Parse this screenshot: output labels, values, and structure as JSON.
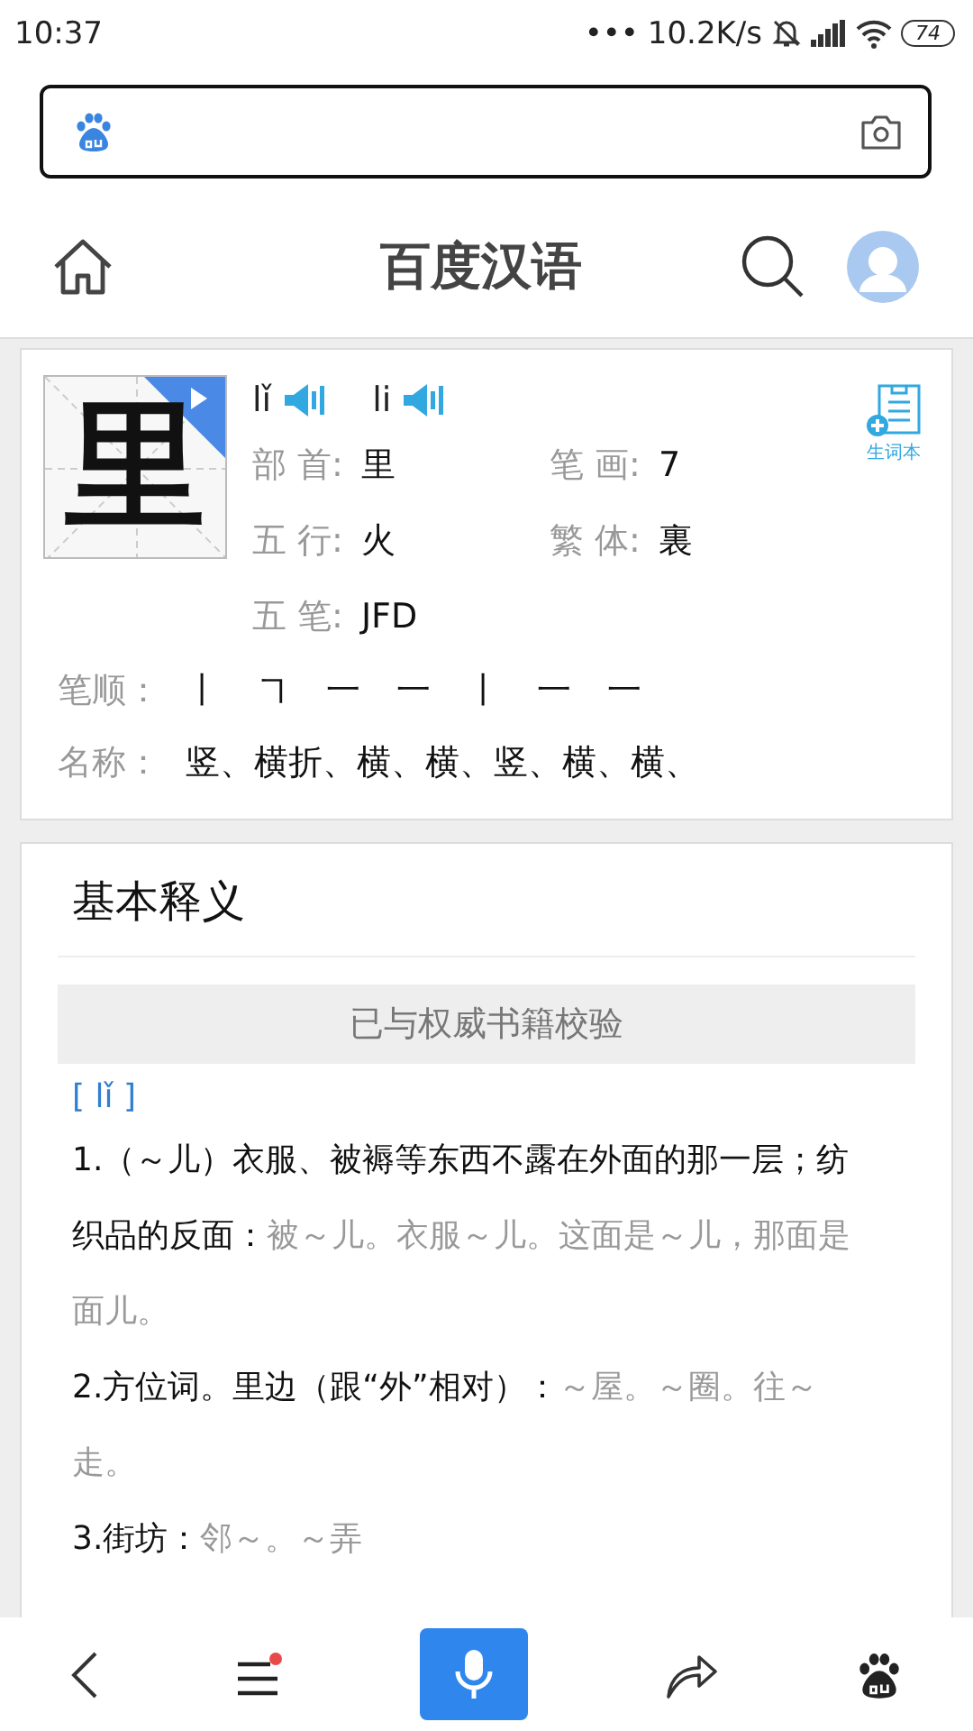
{
  "status_bar": {
    "time": "10:37",
    "dots": "•••",
    "speed": "10.2K/s",
    "battery": "74"
  },
  "header": {
    "title": "百度汉语"
  },
  "character": {
    "glyph": "里",
    "pinyin": [
      {
        "text": "lǐ"
      },
      {
        "text": "li"
      }
    ],
    "add_label": "生词本",
    "fields": [
      {
        "label": "部 首:",
        "value": "里"
      },
      {
        "label": "笔 画:",
        "value": "7"
      },
      {
        "label": "五 行:",
        "value": "火"
      },
      {
        "label": "繁 体:",
        "value": "裏"
      },
      {
        "label": "五 笔:",
        "value": "JFD"
      }
    ],
    "stroke_label": "笔顺：",
    "strokes": [
      "丨",
      "㇕",
      "一",
      "一",
      "丨",
      "一",
      "一"
    ],
    "names_label": "名称：",
    "names": "竖、横折、横、横、竖、横、横、"
  },
  "definitions": {
    "title": "基本释义",
    "verified": "已与权威书籍校验",
    "reading": "[ lǐ ]",
    "items": [
      {
        "text": "1.（～儿）衣服、被褥等东西不露在外面的那一层；纺织品的反面：",
        "example": "被～儿。衣服～儿。这面是～儿，那面是面儿。"
      },
      {
        "text": "2.方位词。里边（跟“外”相对）：",
        "example": "～屋。～圈。往～走。"
      },
      {
        "text": "3.街坊：",
        "example": "邻～。～弄"
      }
    ]
  },
  "bottom_nav": {
    "menu_badge": true
  }
}
